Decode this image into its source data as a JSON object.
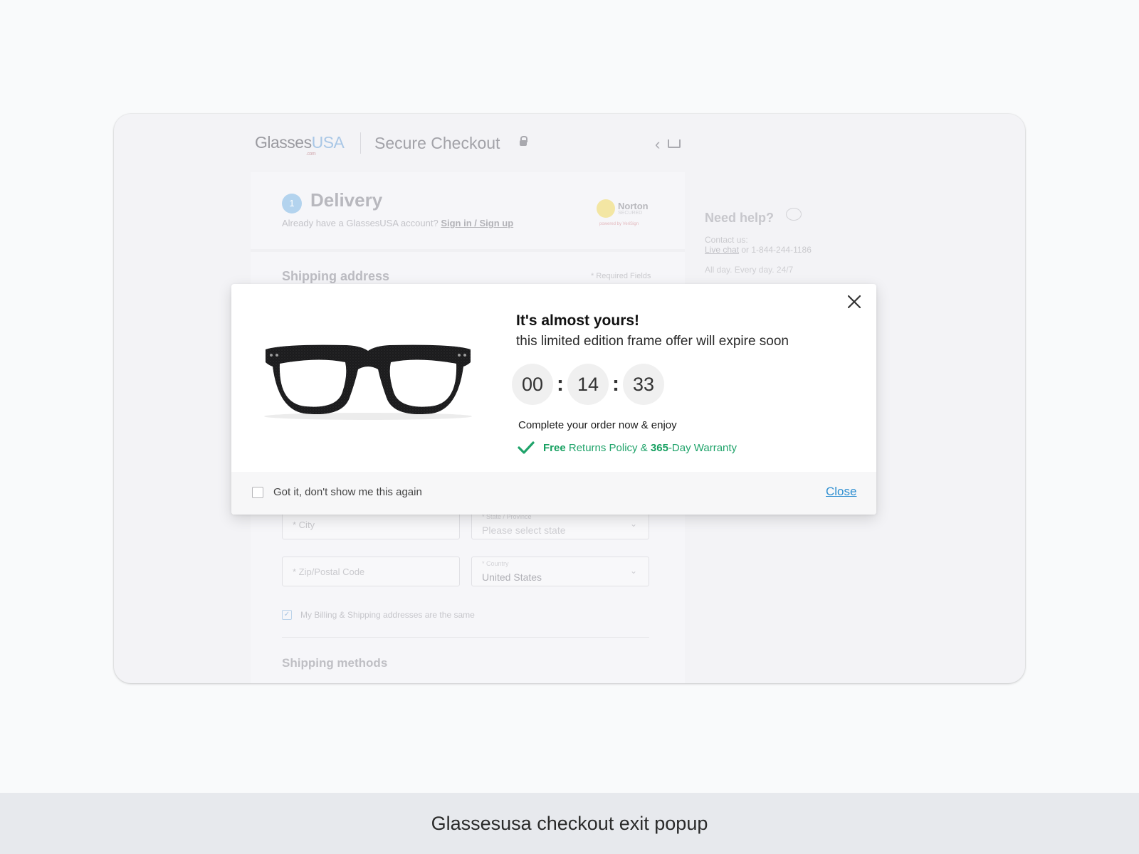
{
  "header": {
    "logo_main": "Glasses",
    "logo_accent": "USA",
    "logo_suffix": ".com",
    "title": "Secure Checkout"
  },
  "delivery": {
    "step": "1",
    "title": "Delivery",
    "account_prompt": "Already have a GlassesUSA account?",
    "signin_link": "Sign in / Sign up",
    "norton": {
      "name": "Norton",
      "secured": "SECURED",
      "powered": "powered by VeriSign"
    }
  },
  "shipping_address": {
    "title": "Shipping address",
    "required_note": "* Required Fields",
    "city_placeholder": "* City",
    "state_label": "* State / Province",
    "state_placeholder": "Please select state",
    "zip_placeholder": "* Zip/Postal Code",
    "country_label": "* Country",
    "country_value": "United States",
    "billing_same_label": "My Billing & Shipping addresses are the same",
    "billing_same_checked": true
  },
  "shipping_methods": {
    "title": "Shipping methods"
  },
  "help": {
    "title": "Need help?",
    "contact_label": "Contact us:",
    "live_chat": "Live chat",
    "or_phone": " or 1-844-244-1186",
    "hours": "All day. Every day. 24/7"
  },
  "modal": {
    "heading": "It's almost yours!",
    "subheading": "this limited edition frame offer will expire soon",
    "timer": {
      "hours": "00",
      "minutes": "14",
      "seconds": "33",
      "separator": ":"
    },
    "complete_text": "Complete your order now & enjoy",
    "benefit": {
      "part1_bold": "Free",
      "part2": " Returns Policy & ",
      "part3_bold": "365",
      "part4": "-Day Warranty"
    },
    "dont_show_label": "Got it, don't show me this again",
    "dont_show_checked": false,
    "close_label": "Close"
  },
  "caption": "Glassesusa checkout exit popup",
  "colors": {
    "accent_green": "#1fa36a",
    "link_blue": "#2f8fd1",
    "page_bg": "#f9fafb"
  },
  "icons": [
    "lock-icon",
    "back-chevron-icon",
    "cart-icon",
    "chat-bubble-icon",
    "close-icon",
    "checkmark-icon",
    "glasses-product-image"
  ]
}
